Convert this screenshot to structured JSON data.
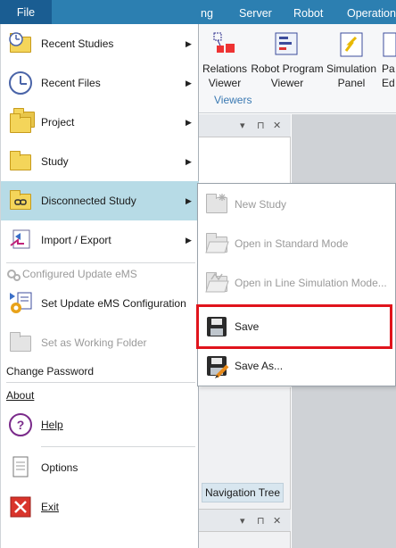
{
  "ribbon": {
    "tabs": [
      {
        "label": "ng"
      },
      {
        "label": "Server"
      },
      {
        "label": "Robot"
      },
      {
        "label": "Operation"
      }
    ],
    "buttons": [
      {
        "label_line1": "Relations",
        "label_line2": "Viewer",
        "icon": "relations-viewer-icon"
      },
      {
        "label_line1": "Robot Program",
        "label_line2": "Viewer",
        "icon": "robot-program-viewer-icon"
      },
      {
        "label_line1": "Simulation",
        "label_line2": "Panel",
        "icon": "simulation-panel-icon"
      },
      {
        "label_line1": "Pa",
        "label_line2": "Ed",
        "icon": "path-editor-icon"
      }
    ],
    "group_label": "Viewers"
  },
  "panes": {
    "navigation_tree_tab": "Navigation Tree",
    "controls": {
      "dropdown": "▾",
      "pin": "⊓",
      "close": "✕"
    }
  },
  "file_menu": {
    "tab_label": "File",
    "items": [
      {
        "label": "Recent Studies",
        "icon": "recent-studies-icon",
        "has_submenu": true
      },
      {
        "label": "Recent Files",
        "icon": "recent-files-clock-icon",
        "has_submenu": true
      },
      {
        "label": "Project",
        "icon": "project-folder-icon",
        "has_submenu": true
      },
      {
        "label": "Study",
        "icon": "study-folder-icon",
        "has_submenu": true
      },
      {
        "label": "Disconnected Study",
        "icon": "disconnected-study-icon",
        "has_submenu": true,
        "active": true
      },
      {
        "label": "Import / Export",
        "icon": "import-export-icon",
        "has_submenu": true
      },
      {
        "label": "Configured Update eMS",
        "icon": "configured-update-ems-icon",
        "disabled": true
      },
      {
        "label": "Set Update eMS Configuration",
        "icon": "set-update-ems-configuration-icon"
      },
      {
        "label": "Set as Working Folder",
        "icon": "working-folder-icon",
        "disabled": true
      },
      {
        "label": "Change Password"
      },
      {
        "label": "About"
      },
      {
        "label": "Help",
        "icon": "help-icon"
      },
      {
        "label": "Options",
        "icon": "options-icon"
      },
      {
        "label": "Exit",
        "icon": "exit-icon"
      }
    ],
    "submenu_arrow": "▶"
  },
  "submenu": {
    "items": [
      {
        "label": "New Study",
        "icon": "new-study-icon",
        "disabled": true
      },
      {
        "label": "Open in Standard Mode",
        "icon": "open-standard-mode-icon",
        "disabled": true
      },
      {
        "label": "Open in Line Simulation Mode...",
        "icon": "open-line-simulation-mode-icon",
        "disabled": true
      },
      {
        "label": "Save",
        "icon": "save-floppy-icon",
        "highlighted": true
      },
      {
        "label": "Save As...",
        "icon": "save-as-icon"
      }
    ],
    "highlight_color": "#e0141c"
  },
  "colors": {
    "ribbon_tab_bar": "#2c7fb1",
    "file_tab": "#1a5d92",
    "menu_active": "#b7dbe6",
    "disabled_text": "#9a9a9a"
  }
}
